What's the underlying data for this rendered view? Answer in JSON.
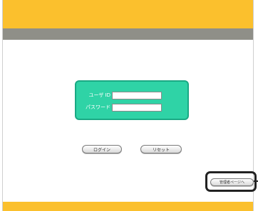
{
  "login_form": {
    "user_id_label": "ユーザ ID",
    "password_label": "パスワード",
    "user_id_value": "",
    "password_value": ""
  },
  "buttons": {
    "login_label": "ログイン",
    "reset_label": "リセット",
    "admin_label": "管理者ページへ"
  },
  "colors": {
    "header_yellow": "#fbc02d",
    "header_gray": "#8f8f88",
    "login_box_green": "#2fd3a6",
    "highlight_border": "#222222"
  }
}
